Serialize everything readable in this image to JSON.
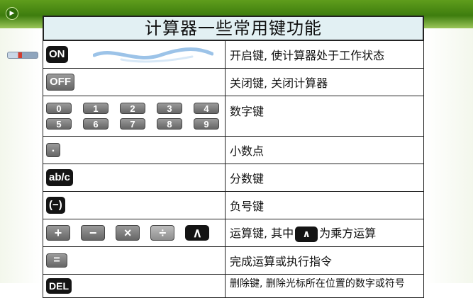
{
  "title": "计算器一些常用键功能",
  "rows": [
    {
      "keys": [
        "ON"
      ],
      "description": "开启键, 使计算器处于工作状态"
    },
    {
      "keys": [
        "OFF"
      ],
      "description": "关闭键, 关闭计算器"
    },
    {
      "keys": [
        "0",
        "1",
        "2",
        "3",
        "4",
        "5",
        "6",
        "7",
        "8",
        "9"
      ],
      "description": "数字键"
    },
    {
      "keys": [
        "."
      ],
      "description": "小数点"
    },
    {
      "keys": [
        "ab/c"
      ],
      "description": "分数键"
    },
    {
      "keys": [
        "(−)"
      ],
      "description": "负号键"
    },
    {
      "keys": [
        "+",
        "−",
        "×",
        "÷",
        "∧"
      ],
      "description_before": "运算键, 其中",
      "description_key": "∧",
      "description_after": "为乘方运算"
    },
    {
      "keys": [
        "="
      ],
      "description": "完成运算或执行指令"
    },
    {
      "keys": [
        "DEL"
      ],
      "description": "删除键, 删除光标所在位置的数字或符号"
    }
  ],
  "icons": {
    "nav": "play-circle-icon",
    "pen": "pen-icon",
    "wave": "decorative-wave-icon"
  },
  "colors": {
    "top_bar": "#3e7d0e",
    "title_band": "#e2f0f3",
    "key_dark": "#141414",
    "key_gray": "#777777"
  }
}
